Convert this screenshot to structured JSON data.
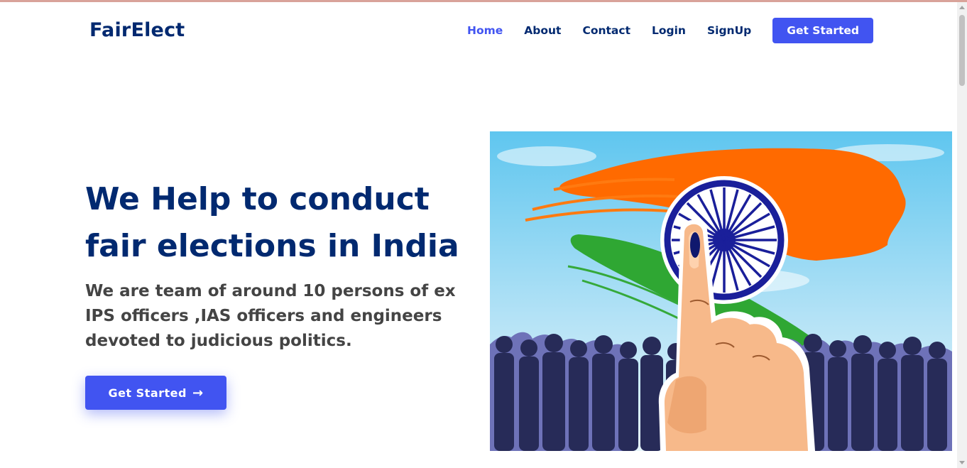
{
  "brand": {
    "name": "FairElect",
    "color": "#012970",
    "accent": "#4154f1"
  },
  "nav": {
    "items": [
      {
        "label": "Home",
        "active": true
      },
      {
        "label": "About",
        "active": false
      },
      {
        "label": "Contact",
        "active": false
      },
      {
        "label": "Login",
        "active": false
      },
      {
        "label": "SignUp",
        "active": false
      }
    ],
    "cta_label": "Get Started"
  },
  "hero": {
    "title": "We Help to conduct fair elections in India",
    "subtitle": "We are team of around 10 persons of ex IPS officers ,IAS officers and engineers devoted to judicious politics.",
    "button_label": "Get Started",
    "button_icon": "arrow-right-icon",
    "image": "voting-finger-indian-flag-crowd-illustration"
  }
}
